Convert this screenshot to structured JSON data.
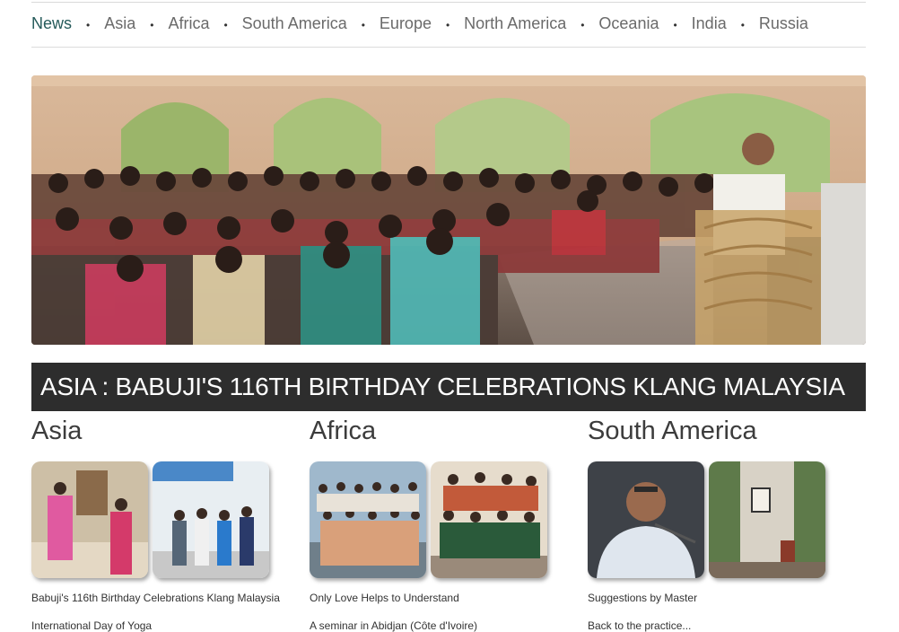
{
  "nav": {
    "items": [
      {
        "label": "News",
        "active": true
      },
      {
        "label": "Asia"
      },
      {
        "label": "Africa"
      },
      {
        "label": "South America"
      },
      {
        "label": "Europe"
      },
      {
        "label": "North America"
      },
      {
        "label": "Oceania"
      },
      {
        "label": "India"
      },
      {
        "label": "Russia"
      }
    ],
    "separator": "•"
  },
  "hero": {
    "headline": "ASIA : BABUJI'S 116TH BIRTHDAY CELEBRATIONS KLANG MALAYSIA"
  },
  "regions": [
    {
      "title": "Asia",
      "stories": [
        "Babuji's 116th Birthday Celebrations Klang Malaysia",
        "International Day of Yoga"
      ]
    },
    {
      "title": "Africa",
      "stories": [
        "Only Love Helps to Understand",
        "A seminar in Abidjan (Côte d'Ivoire)"
      ]
    },
    {
      "title": "South America",
      "stories": [
        "Suggestions by Master",
        "Back to the practice..."
      ]
    }
  ],
  "colors": {
    "nav_active": "#255a5a",
    "nav_text": "#6a6a6a",
    "headline_bar": "#2d2d2d"
  }
}
